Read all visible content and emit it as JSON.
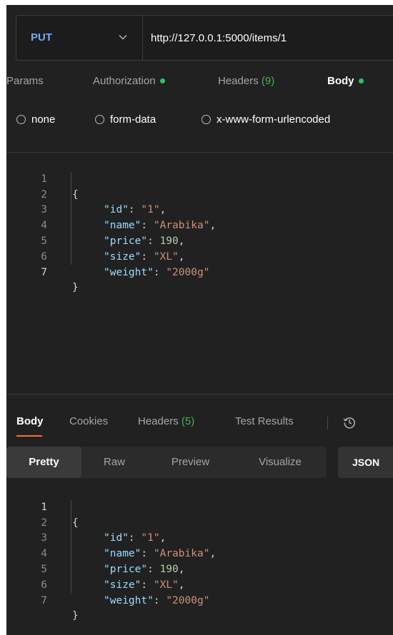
{
  "request": {
    "method": "PUT",
    "url": "http://127.0.0.1:5000/items/1",
    "tabs": [
      {
        "label": "Params"
      },
      {
        "label": "Authorization"
      },
      {
        "label": "Headers",
        "count": "(9)"
      },
      {
        "label": "Body"
      }
    ],
    "active_tab": "Body",
    "body_types": [
      "none",
      "form-data",
      "x-www-form-urlencoded"
    ],
    "body": {
      "line_numbers": [
        "1",
        "2",
        "3",
        "4",
        "5",
        "6",
        "7"
      ],
      "open_brace": "{",
      "close_brace": "}",
      "fields": [
        {
          "key": "\"id\"",
          "value": "\"1\"",
          "value_type": "string",
          "sep": ","
        },
        {
          "key": "\"name\"",
          "value": "\"Arabika\"",
          "value_type": "string",
          "sep": ","
        },
        {
          "key": "\"price\"",
          "value": "190",
          "value_type": "number",
          "sep": ","
        },
        {
          "key": "\"size\"",
          "value": "\"XL\"",
          "value_type": "string",
          "sep": ","
        },
        {
          "key": "\"weight\"",
          "value": "\"2000g\"",
          "value_type": "string",
          "sep": ""
        }
      ]
    }
  },
  "response": {
    "tabs": [
      {
        "label": "Body"
      },
      {
        "label": "Cookies"
      },
      {
        "label": "Headers",
        "count": "(5)"
      },
      {
        "label": "Test Results"
      }
    ],
    "active_tab": "Body",
    "history_icon": "history-icon",
    "format_options": [
      "Pretty",
      "Raw",
      "Preview",
      "Visualize"
    ],
    "active_format": "Pretty",
    "language": "JSON",
    "body": {
      "line_numbers": [
        "1",
        "2",
        "3",
        "4",
        "5",
        "6",
        "7"
      ],
      "open_brace": "{",
      "close_brace": "}",
      "fields": [
        {
          "key": "\"id\"",
          "value": "\"1\"",
          "value_type": "string",
          "sep": ","
        },
        {
          "key": "\"name\"",
          "value": "\"Arabika\"",
          "value_type": "string",
          "sep": ","
        },
        {
          "key": "\"price\"",
          "value": "190",
          "value_type": "number",
          "sep": ","
        },
        {
          "key": "\"size\"",
          "value": "\"XL\"",
          "value_type": "string",
          "sep": ","
        },
        {
          "key": "\"weight\"",
          "value": "\"2000g\"",
          "value_type": "string",
          "sep": ""
        }
      ]
    }
  },
  "colors": {
    "accent": "#ff6c37",
    "method": "#76a9fa",
    "status_dot": "#2ec26b",
    "count": "#4caf50",
    "json_key": "#9cdcfe",
    "json_string": "#ce9178",
    "json_number": "#b5cea8"
  }
}
